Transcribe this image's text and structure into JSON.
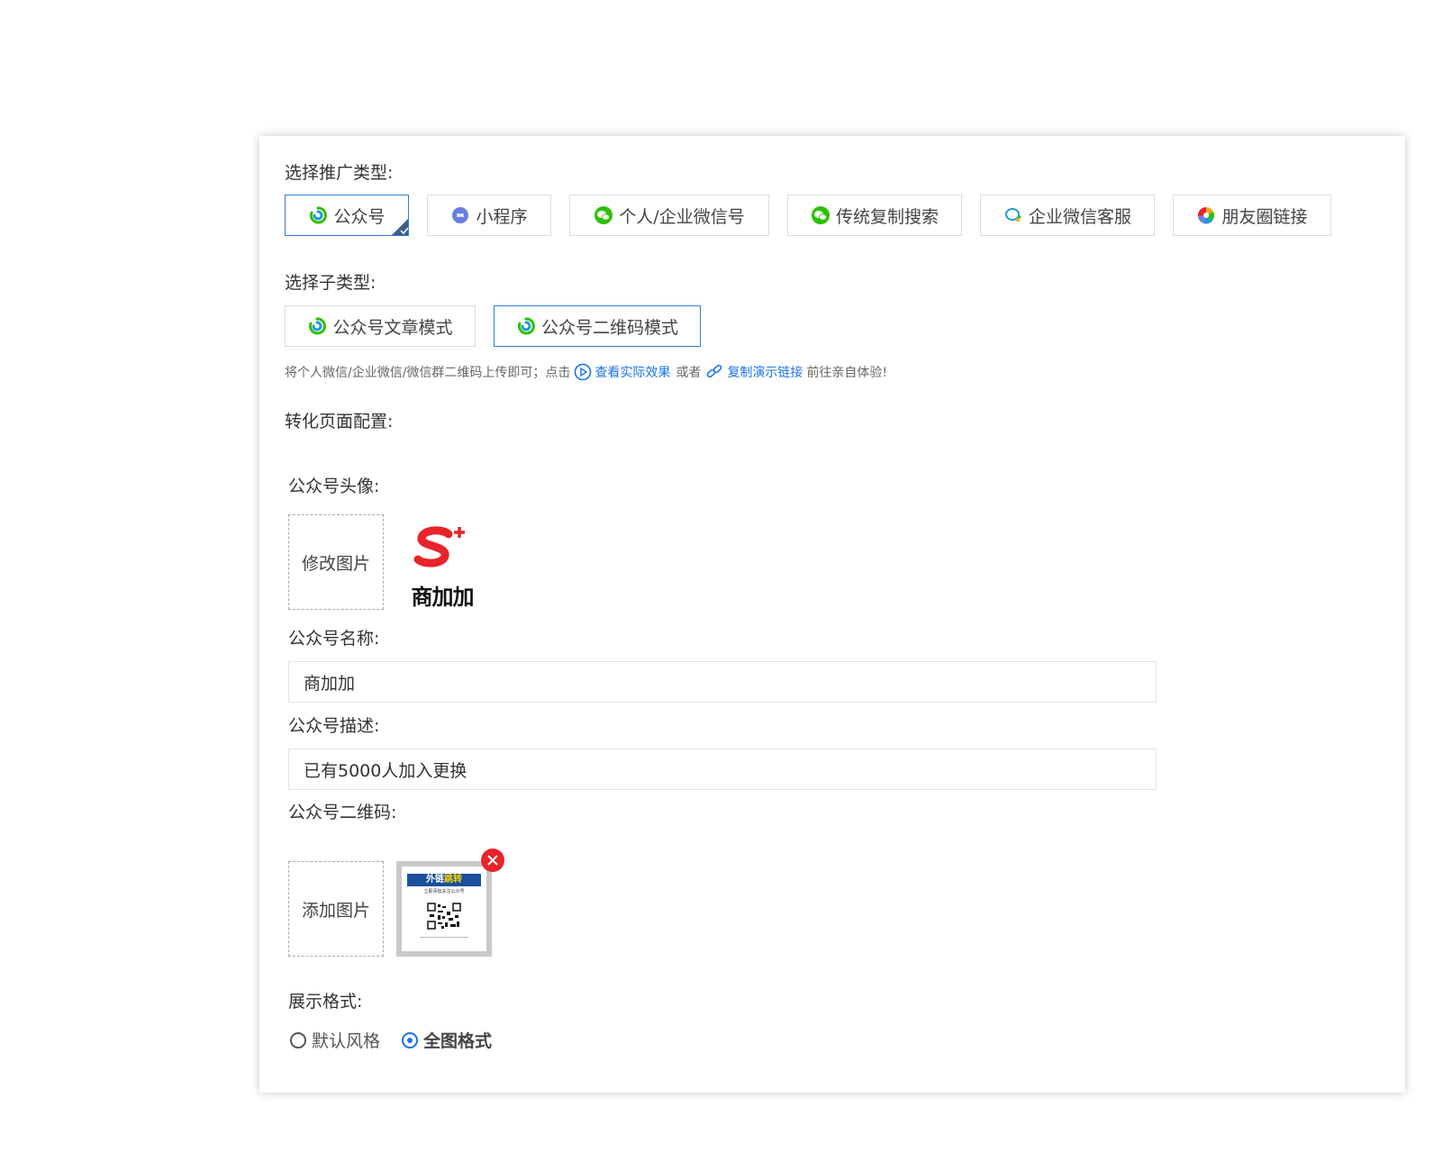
{
  "promo": {
    "label": "选择推广类型:",
    "types": [
      {
        "label": "公众号",
        "icon": "wechat-official-icon"
      },
      {
        "label": "小程序",
        "icon": "mini-program-icon"
      },
      {
        "label": "个人/企业微信号",
        "icon": "wechat-icon"
      },
      {
        "label": "传统复制搜索",
        "icon": "wechat-icon"
      },
      {
        "label": "企业微信客服",
        "icon": "work-wechat-icon"
      },
      {
        "label": "朋友圈链接",
        "icon": "moments-icon"
      }
    ],
    "selected": "公众号"
  },
  "subtype": {
    "label": "选择子类型:",
    "items": [
      {
        "label": "公众号文章模式"
      },
      {
        "label": "公众号二维码模式"
      }
    ],
    "selected": "公众号二维码模式"
  },
  "hint": {
    "text": "将个人微信/企业微信/微信群二维码上传即可；点击",
    "view_link": "查看实际效果",
    "or": "或者",
    "copy_link": "复制演示链接",
    "tail": "前往亲自体验!"
  },
  "conversion": {
    "label": "转化页面配置:",
    "avatar_label": "公众号头像:",
    "avatar_button": "修改图片",
    "logo_text": "商加加",
    "name_label": "公众号名称:",
    "name_value": "商加加",
    "desc_label": "公众号描述:",
    "desc_value": "已有5000人加入更换",
    "qr_label": "公众号二维码:",
    "qr_button": "添加图片",
    "qr_banner_a": "外链",
    "qr_banner_b": "跳转",
    "qr_sub": "立即添加关注公众号"
  },
  "display": {
    "label": "展示格式:",
    "options": [
      "默认风格",
      "全图格式"
    ],
    "selected": "全图格式"
  },
  "colors": {
    "accent": "#1a73e8",
    "selected_border": "#2f7fd8",
    "wechat_green": "#2dc100",
    "logo_red": "#e8232a"
  }
}
